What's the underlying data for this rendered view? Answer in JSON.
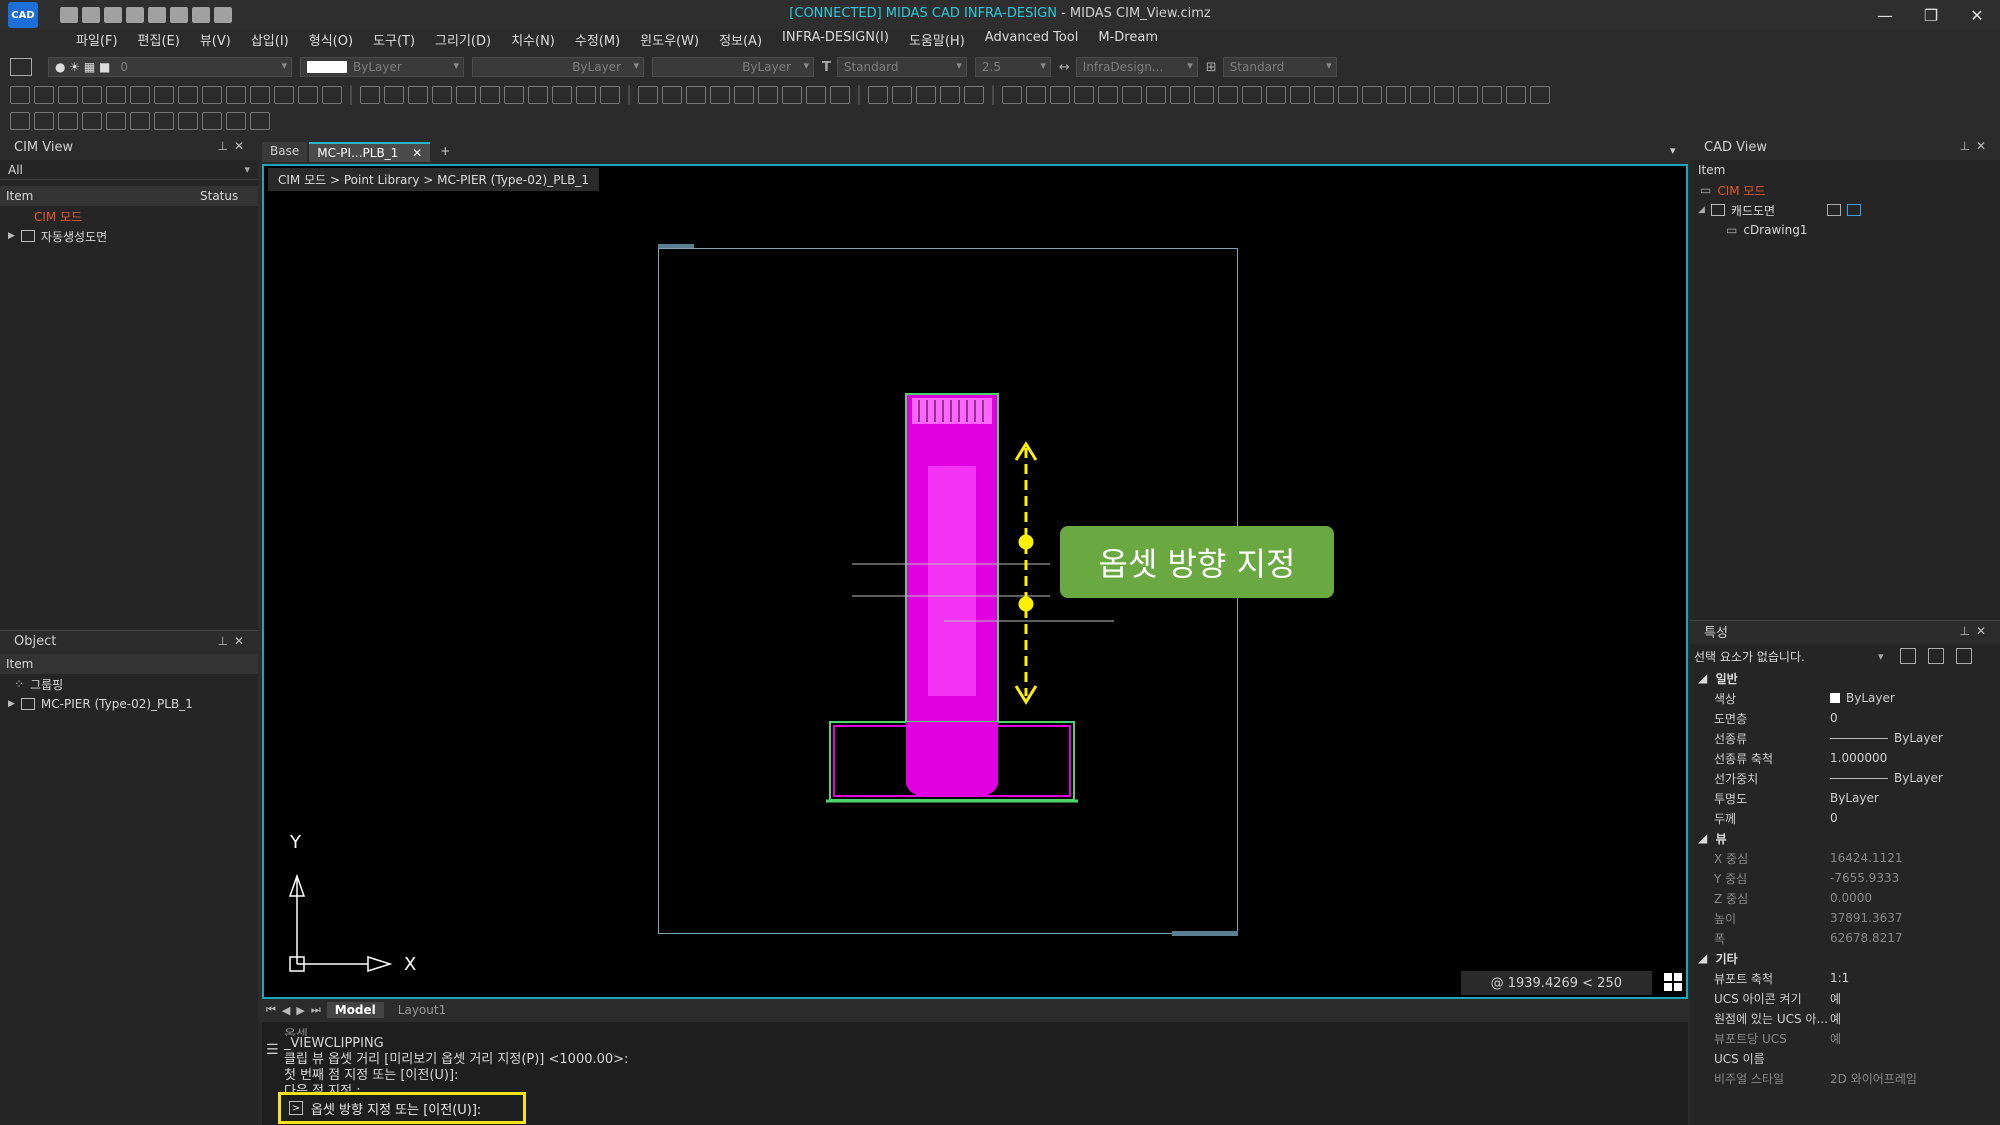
{
  "window": {
    "logo": "CAD",
    "title_connected": "[CONNECTED] MIDAS CAD INFRA-DESIGN",
    "title_rest": " - MIDAS CIM_View.cimz",
    "controls": [
      "—",
      "❐",
      "✕"
    ]
  },
  "menu": [
    "파일(F)",
    "편집(E)",
    "뷰(V)",
    "삽입(I)",
    "형식(O)",
    "도구(T)",
    "그리기(D)",
    "치수(N)",
    "수정(M)",
    "윈도우(W)",
    "정보(A)",
    "INFRA-DESIGN(I)",
    "도움말(H)",
    "Advanced Tool",
    "M-Dream"
  ],
  "toolbar": {
    "layer_value": "0",
    "color_value": "ByLayer",
    "linetype_value": "ByLayer",
    "lineweight_value": "ByLayer",
    "textstyle_value": "Standard",
    "textheight_value": "2.5",
    "dimstyle_value": "InfraDesign...",
    "tablestyle_value": "Standard"
  },
  "cim_view": {
    "title": "CIM View",
    "filter": "All",
    "col_item": "Item",
    "col_status": "Status",
    "root": "CIM 모드",
    "child": "자동생성도면"
  },
  "object_panel": {
    "title": "Object",
    "col_item": "Item",
    "group": "그룹핑",
    "item": "MC-PIER (Type-02)_PLB_1"
  },
  "tabs": {
    "base": "Base",
    "active": "MC-PI...PLB_1",
    "close": "✕",
    "add": "+"
  },
  "viewport": {
    "breadcrumb": "CIM 모드 > Point Library > MC-PIER (Type-02)_PLB_1",
    "callout": "옵셋 방향 지정",
    "axis_x": "X",
    "axis_y": "Y",
    "coords": "@ 1939.4269 < 250"
  },
  "layout_tabs": {
    "model": "Model",
    "layout1": "Layout1"
  },
  "command": {
    "history": [
      "옵셋",
      "_VIEWCLIPPING",
      "클립 뷰 옵셋 거리 [미리보기 옵셋 거리 지정(P)] <1000.00>:",
      "첫 번째 점 지정 또는 [이전(U)]:",
      "다음 점 지정 :"
    ],
    "prompt": "옵셋 방향 지정 또는 [이전(U)]:"
  },
  "cad_view": {
    "title": "CAD View",
    "col_item": "Item",
    "root": "CIM 모드",
    "folder": "캐드도면",
    "drawing": "cDrawing1"
  },
  "properties": {
    "title": "특성",
    "selection": "선택 요소가 없습니다.",
    "cat_general": "일반",
    "cat_view": "뷰",
    "cat_other": "기타",
    "general": [
      {
        "name": "색상",
        "value": "ByLayer"
      },
      {
        "name": "도면층",
        "value": "0"
      },
      {
        "name": "선종류",
        "value": "ByLayer"
      },
      {
        "name": "선종류 축척",
        "value": "1.000000"
      },
      {
        "name": "선가중치",
        "value": "ByLayer"
      },
      {
        "name": "투명도",
        "value": "ByLayer"
      },
      {
        "name": "두께",
        "value": "0"
      }
    ],
    "view": [
      {
        "name": "X 중심",
        "value": "16424.1121"
      },
      {
        "name": "Y 중심",
        "value": "-7655.9333"
      },
      {
        "name": "Z 중심",
        "value": "0.0000"
      },
      {
        "name": "높이",
        "value": "37891.3637"
      },
      {
        "name": "폭",
        "value": "62678.8217"
      }
    ],
    "other": [
      {
        "name": "뷰포트 축척",
        "value": "1:1"
      },
      {
        "name": "UCS 아이콘 켜기",
        "value": "예"
      },
      {
        "name": "원점에 있는 UCS 아...",
        "value": "예"
      },
      {
        "name": "뷰포트당 UCS",
        "value": "예"
      },
      {
        "name": "UCS 이름",
        "value": ""
      },
      {
        "name": "비주얼 스타일",
        "value": "2D 와이어프레임"
      }
    ]
  },
  "colors": {
    "accent": "#1aa7b8",
    "pier": "#ff00ff",
    "guide": "#ffef00",
    "callout": "#6aa942",
    "highlight": "#f4e31b"
  }
}
